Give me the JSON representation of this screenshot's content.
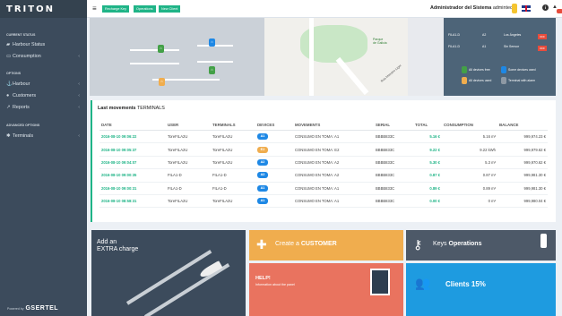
{
  "app": {
    "logo": "TRITON",
    "powered_by": "Powered by",
    "brand": "GSERTEL"
  },
  "sidebar": {
    "section_current": "CURRENT STATUS",
    "section_options": "OPTIONS",
    "section_advanced": "ADVANCED OPTIONS",
    "items": [
      {
        "label": "Harbour Status",
        "icon": "bookmark-icon"
      },
      {
        "label": "Consumption",
        "icon": "flash-icon"
      },
      {
        "label": "Harbour",
        "icon": "anchor-icon"
      },
      {
        "label": "Customers",
        "icon": "users-icon"
      },
      {
        "label": "Reports",
        "icon": "chart-icon"
      },
      {
        "label": "Terminals",
        "icon": "gear-icon"
      }
    ]
  },
  "topbar": {
    "buttons": [
      "Recharge Key",
      "Operations",
      "New Client"
    ],
    "admin_bold": "Administrador del Sistema",
    "admin_user": "admintec"
  },
  "map": {
    "park_label_1": "Parque",
    "park_label_2": "de Galicia",
    "street": "Rúa Maestro Liger",
    "legend_rows": [
      {
        "name": "FILA1-D",
        "port": "A2",
        "status": "Los Ángeles",
        "btn": "OFF"
      },
      {
        "name": "FILA1-D",
        "port": "A1",
        "status": "Sin Sensor",
        "btn": "OFF"
      }
    ],
    "legend_items": [
      "All devices free",
      "Some devices used",
      "All devices used",
      "Terminal with alarm"
    ]
  },
  "movements": {
    "title_bold": "Last movements",
    "title_rest": "TERMINALS",
    "columns": [
      "DATE",
      "USER",
      "TERMINALS",
      "DEVICES",
      "MOVEMENTS",
      "SERIAL",
      "TOTAL",
      "CONSUMPTION",
      "BALANCE"
    ],
    "rows": [
      {
        "date": "2016-08-10 09:06:22",
        "user": "ToreFILA2U",
        "terminal": "ToreFILA2U",
        "device": "A1",
        "dev_color": "#1e88e5",
        "movement": "CONSUMO EN TOMA: A1",
        "serial": "BBBB833C",
        "total": "5.16 €",
        "consumption": "5.16 m³",
        "balance": "999,974.23 €"
      },
      {
        "date": "2016-08-10 09:05:37",
        "user": "ToreFILA2U",
        "terminal": "ToreFILA2U",
        "device": "E2",
        "dev_color": "#f0ad4e",
        "movement": "CONSUMO EN TOMA: E2",
        "serial": "BBBB833C",
        "total": "9.22 €",
        "consumption": "9.22 kWh",
        "balance": "999,979.62 €"
      },
      {
        "date": "2016-08-10 09:04:07",
        "user": "ToreFILA2U",
        "terminal": "ToreFILA2U",
        "device": "A2",
        "dev_color": "#1e88e5",
        "movement": "CONSUMO EN TOMA: A2",
        "serial": "BBBB833C",
        "total": "5.30 €",
        "consumption": "5.3 m³",
        "balance": "999,970.62 €"
      },
      {
        "date": "2016-08-10 09:00:35",
        "user": "FILA1-D",
        "terminal": "FILA1-D",
        "device": "A2",
        "dev_color": "#1e88e5",
        "movement": "CONSUMO EN TOMA: A2",
        "serial": "BBBB833C",
        "total": "0.87 €",
        "consumption": "0.87 m³",
        "balance": "999,981.30 €"
      },
      {
        "date": "2016-08-10 09:00:31",
        "user": "FILA1-D",
        "terminal": "FILA1-D",
        "device": "A1",
        "dev_color": "#1e88e5",
        "movement": "CONSUMO EN TOMA: A1",
        "serial": "BBBB833C",
        "total": "0.89 €",
        "consumption": "0.89 m³",
        "balance": "999,981.30 €"
      },
      {
        "date": "2016-08-10 08:58:31",
        "user": "ToreFILA2U",
        "terminal": "ToreFILA2U",
        "device": "A1",
        "dev_color": "#1e88e5",
        "movement": "CONSUMO EN TOMA: A1",
        "serial": "BBBB833C",
        "total": "0.00 €",
        "consumption": "0 m³",
        "balance": "999,980.04 €"
      }
    ]
  },
  "tiles": {
    "extra_line1": "Add an",
    "extra_line2": "EXTRA charge",
    "customer_pre": "Create a",
    "customer_bold": "CUSTOMER",
    "ops_pre": "Keys",
    "ops_bold": "Operations",
    "help_title": "HELP!",
    "help_sub": "Information about the panel",
    "clients": "Clients 15%"
  }
}
